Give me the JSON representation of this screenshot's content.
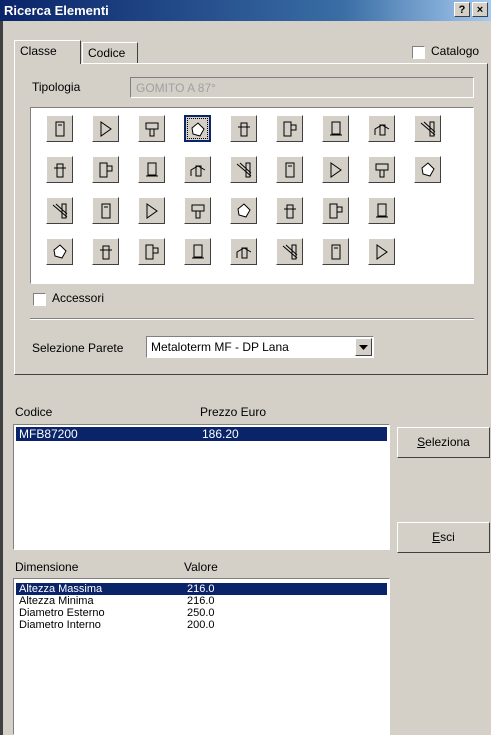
{
  "window": {
    "title": "Ricerca Elementi",
    "help_glyph": "?",
    "close_glyph": "×"
  },
  "tabs": [
    {
      "label": "Classe"
    },
    {
      "label": "Codice"
    }
  ],
  "catalogo": {
    "label": "Catalogo",
    "checked": false
  },
  "tipologia": {
    "label": "Tipologia",
    "value": "GOMITO A 87°"
  },
  "icon_grid": {
    "selected_index": 3,
    "icons": [
      "pipe-straight-icon",
      "pipe-support-icon",
      "wall-bracket-icon",
      "elbow-87-icon",
      "roof-flashing-icon",
      "tee-pipe-icon",
      "inspection-element-icon",
      "elbow-45-icon",
      "tee-branch-icon",
      "cap-round-icon",
      "pipe-vent-icon",
      "drain-cup-icon",
      "elbow-30-icon",
      "base-support-icon",
      "elbow-offset-icon",
      "wall-plate-icon",
      "access-door-icon",
      "wall-anchor-icon",
      "chimney-top-icon",
      "floor-plate-icon",
      "condensate-elbow-icon",
      "cowl-icon",
      "side-inlet-icon",
      "rain-cap-icon",
      "floor-ring-icon",
      "round-inspection-icon",
      "",
      "pipe-length-icon",
      "floor-support-icon",
      "elbow-15-icon",
      "adapter-icon",
      "reducer-icon",
      "wall-crossing-icon",
      "sensor-element-icon",
      "terminal-icon",
      ""
    ]
  },
  "accessori": {
    "label": "Accessori",
    "checked": false
  },
  "selezione_parete": {
    "label": "Selezione Parete",
    "value": "Metaloterm MF - DP Lana"
  },
  "codes_list": {
    "headers": [
      "Codice",
      "Prezzo Euro"
    ],
    "rows": [
      {
        "codice": "MFB87200",
        "prezzo": "186.20",
        "selected": true
      }
    ]
  },
  "buttons": {
    "seleziona": {
      "label": "eleziona",
      "mnemonic": "S"
    },
    "esci": {
      "label": "sci",
      "mnemonic": "E"
    }
  },
  "dims_list": {
    "headers": [
      "Dimensione",
      "Valore"
    ],
    "rows": [
      {
        "dimensione": "Altezza Massima",
        "valore": "216.0",
        "selected": true
      },
      {
        "dimensione": "Altezza Minima",
        "valore": "216.0",
        "selected": false
      },
      {
        "dimensione": "Diametro Esterno",
        "valore": "250.0",
        "selected": false
      },
      {
        "dimensione": "Diametro Interno",
        "valore": "200.0",
        "selected": false
      }
    ]
  }
}
